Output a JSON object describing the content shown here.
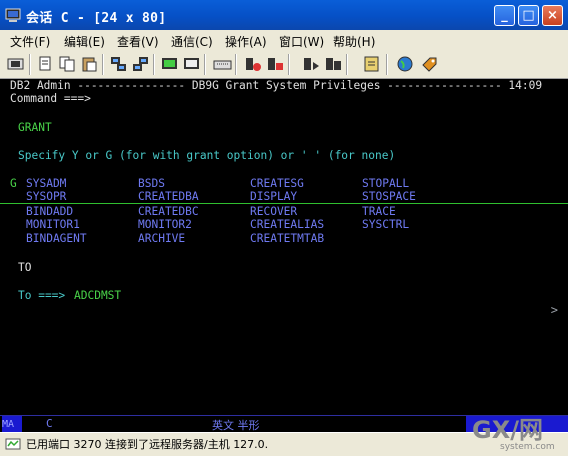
{
  "window": {
    "title": "会话 C - [24 x 80]"
  },
  "window_controls": {
    "minimize": "_",
    "maximize": "□",
    "close": "×"
  },
  "menu": [
    "文件(F)",
    "编辑(E)",
    "查看(V)",
    "通信(C)",
    "操作(A)",
    "窗口(W)",
    "帮助(H)"
  ],
  "toolbar": {
    "button_count": 18
  },
  "terminal": {
    "header": "DB2 Admin ---------------- DB9G Grant System Privileges ----------------- 14:09",
    "command_prompt": "Command ===>",
    "section": "GRANT",
    "instruction": "Specify Y or G (for with grant option) or ' ' (for none)",
    "grant_indicator": "G",
    "privileges": [
      [
        "SYSADM",
        "BSDS",
        "CREATESG",
        "STOPALL"
      ],
      [
        "SYSOPR",
        "CREATEDBA",
        "DISPLAY",
        "STOSPACE"
      ],
      [
        "BINDADD",
        "CREATEDBC",
        "RECOVER",
        "TRACE"
      ],
      [
        "MONITOR1",
        "MONITOR2",
        "CREATEALIAS",
        "SYSCTRL"
      ],
      [
        "BINDAGENT",
        "ARCHIVE",
        "CREATETMTAB",
        ""
      ]
    ],
    "to_label": "TO",
    "to_prompt": "To ===>",
    "to_value": "ADCDMST",
    "scroll_indicator": ">"
  },
  "oia": {
    "mode": "MA",
    "session": "C",
    "ime": "英文 半形"
  },
  "status": {
    "text": "已用端口 3270 连接到了远程服务器/主机 127.0."
  },
  "watermark": {
    "text": "GX/网",
    "sub": "system.com"
  },
  "colors": {
    "title_bar": "#0650c6",
    "terminal_bg": "#000000",
    "field_blue": "#6f7af2",
    "input_green": "#49d349"
  }
}
